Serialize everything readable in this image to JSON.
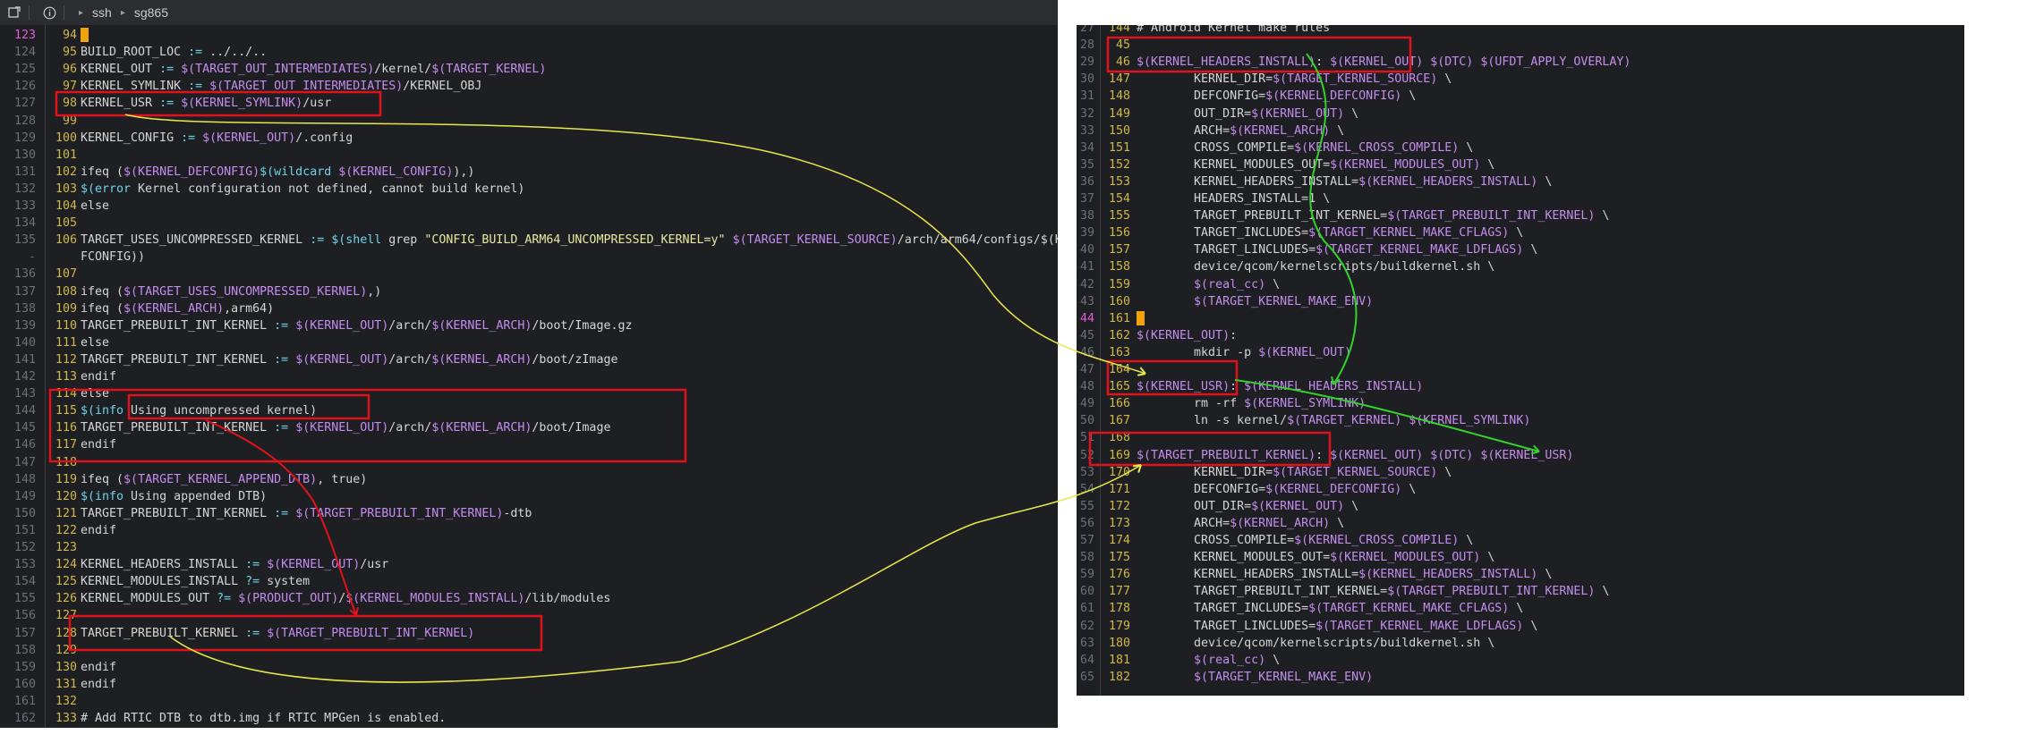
{
  "titlebar": {
    "crumbs": [
      "ssh",
      "sg865"
    ]
  },
  "colors": {
    "editor_bg": "#1e1f22",
    "text": "#d5d5d5",
    "linenum": "#6b7079",
    "rel_linenum": "#d1b84a",
    "current_line": "#e45ad8",
    "highlight_box": "#e0121b",
    "arrow_yellow": "#e8e84a",
    "arrow_red": "#e0121b",
    "arrow_green": "#34d12e",
    "purple_var": "#c58cf0",
    "cyan_op": "#6fd3e8",
    "comment": "#d5d5d5"
  },
  "left_editor": {
    "lines": [
      {
        "ln1": "123",
        "ln2": "94",
        "text": "",
        "cursor": true,
        "current": true
      },
      {
        "ln1": "124",
        "ln2": "95",
        "text": "BUILD_ROOT_LOC := ../../.."
      },
      {
        "ln1": "125",
        "ln2": "96",
        "text": "KERNEL_OUT := $(TARGET_OUT_INTERMEDIATES)/kernel/$(TARGET_KERNEL)"
      },
      {
        "ln1": "126",
        "ln2": "97",
        "text": "KERNEL_SYMLINK := $(TARGET_OUT_INTERMEDIATES)/KERNEL_OBJ"
      },
      {
        "ln1": "127",
        "ln2": "98",
        "text": "KERNEL_USR := $(KERNEL_SYMLINK)/usr"
      },
      {
        "ln1": "128",
        "ln2": "99",
        "text": ""
      },
      {
        "ln1": "129",
        "ln2": "100",
        "text": "KERNEL_CONFIG := $(KERNEL_OUT)/.config"
      },
      {
        "ln1": "130",
        "ln2": "101",
        "text": ""
      },
      {
        "ln1": "131",
        "ln2": "102",
        "text": "ifeq ($(KERNEL_DEFCONFIG)$(wildcard $(KERNEL_CONFIG)),)"
      },
      {
        "ln1": "132",
        "ln2": "103",
        "text": "$(error Kernel configuration not defined, cannot build kernel)"
      },
      {
        "ln1": "133",
        "ln2": "104",
        "text": "else"
      },
      {
        "ln1": "134",
        "ln2": "105",
        "text": ""
      },
      {
        "ln1": "135",
        "ln2": "106",
        "text": "TARGET_USES_UNCOMPRESSED_KERNEL := $(shell grep \"CONFIG_BUILD_ARM64_UNCOMPRESSED_KERNEL=y\" $(TARGET_KERNEL_SOURCE)/arch/arm64/configs/$(KERNEL_DE"
      },
      {
        "ln1": "-",
        "ln2": "",
        "text": "FCONFIG))"
      },
      {
        "ln1": "136",
        "ln2": "107",
        "text": ""
      },
      {
        "ln1": "137",
        "ln2": "108",
        "text": "ifeq ($(TARGET_USES_UNCOMPRESSED_KERNEL),)"
      },
      {
        "ln1": "138",
        "ln2": "109",
        "text": "ifeq ($(KERNEL_ARCH),arm64)"
      },
      {
        "ln1": "139",
        "ln2": "110",
        "text": "TARGET_PREBUILT_INT_KERNEL := $(KERNEL_OUT)/arch/$(KERNEL_ARCH)/boot/Image.gz"
      },
      {
        "ln1": "140",
        "ln2": "111",
        "text": "else"
      },
      {
        "ln1": "141",
        "ln2": "112",
        "text": "TARGET_PREBUILT_INT_KERNEL := $(KERNEL_OUT)/arch/$(KERNEL_ARCH)/boot/zImage"
      },
      {
        "ln1": "142",
        "ln2": "113",
        "text": "endif"
      },
      {
        "ln1": "143",
        "ln2": "114",
        "text": "else"
      },
      {
        "ln1": "144",
        "ln2": "115",
        "text": "$(info Using uncompressed kernel)"
      },
      {
        "ln1": "145",
        "ln2": "116",
        "text": "TARGET_PREBUILT_INT_KERNEL := $(KERNEL_OUT)/arch/$(KERNEL_ARCH)/boot/Image"
      },
      {
        "ln1": "146",
        "ln2": "117",
        "text": "endif"
      },
      {
        "ln1": "147",
        "ln2": "118",
        "text": ""
      },
      {
        "ln1": "148",
        "ln2": "119",
        "text": "ifeq ($(TARGET_KERNEL_APPEND_DTB), true)"
      },
      {
        "ln1": "149",
        "ln2": "120",
        "text": "$(info Using appended DTB)"
      },
      {
        "ln1": "150",
        "ln2": "121",
        "text": "TARGET_PREBUILT_INT_KERNEL := $(TARGET_PREBUILT_INT_KERNEL)-dtb"
      },
      {
        "ln1": "151",
        "ln2": "122",
        "text": "endif"
      },
      {
        "ln1": "152",
        "ln2": "123",
        "text": ""
      },
      {
        "ln1": "153",
        "ln2": "124",
        "text": "KERNEL_HEADERS_INSTALL := $(KERNEL_OUT)/usr"
      },
      {
        "ln1": "154",
        "ln2": "125",
        "text": "KERNEL_MODULES_INSTALL ?= system"
      },
      {
        "ln1": "155",
        "ln2": "126",
        "text": "KERNEL_MODULES_OUT ?= $(PRODUCT_OUT)/$(KERNEL_MODULES_INSTALL)/lib/modules"
      },
      {
        "ln1": "156",
        "ln2": "127",
        "text": ""
      },
      {
        "ln1": "157",
        "ln2": "128",
        "text": "TARGET_PREBUILT_KERNEL := $(TARGET_PREBUILT_INT_KERNEL)"
      },
      {
        "ln1": "158",
        "ln2": "129",
        "text": ""
      },
      {
        "ln1": "159",
        "ln2": "130",
        "text": "endif"
      },
      {
        "ln1": "160",
        "ln2": "131",
        "text": "endif"
      },
      {
        "ln1": "161",
        "ln2": "132",
        "text": ""
      },
      {
        "ln1": "162",
        "ln2": "133",
        "text": "# Add RTIC DTB to dtb.img if RTIC MPGen is enabled."
      }
    ]
  },
  "right_editor": {
    "lines": [
      {
        "ln1": "27",
        "ln2": "144",
        "text": "# Android Kernel make rules"
      },
      {
        "ln1": "28",
        "ln2": "45",
        "text": ""
      },
      {
        "ln1": "29",
        "ln2": "46",
        "text": "$(KERNEL_HEADERS_INSTALL): $(KERNEL_OUT) $(DTC) $(UFDT_APPLY_OVERLAY)"
      },
      {
        "ln1": "30",
        "ln2": "147",
        "text": "        KERNEL_DIR=$(TARGET_KERNEL_SOURCE) \\"
      },
      {
        "ln1": "31",
        "ln2": "148",
        "text": "        DEFCONFIG=$(KERNEL_DEFCONFIG) \\"
      },
      {
        "ln1": "32",
        "ln2": "149",
        "text": "        OUT_DIR=$(KERNEL_OUT) \\"
      },
      {
        "ln1": "33",
        "ln2": "150",
        "text": "        ARCH=$(KERNEL_ARCH) \\"
      },
      {
        "ln1": "34",
        "ln2": "151",
        "text": "        CROSS_COMPILE=$(KERNEL_CROSS_COMPILE) \\"
      },
      {
        "ln1": "35",
        "ln2": "152",
        "text": "        KERNEL_MODULES_OUT=$(KERNEL_MODULES_OUT) \\"
      },
      {
        "ln1": "36",
        "ln2": "153",
        "text": "        KERNEL_HEADERS_INSTALL=$(KERNEL_HEADERS_INSTALL) \\"
      },
      {
        "ln1": "37",
        "ln2": "154",
        "text": "        HEADERS_INSTALL=1 \\"
      },
      {
        "ln1": "38",
        "ln2": "155",
        "text": "        TARGET_PREBUILT_INT_KERNEL=$(TARGET_PREBUILT_INT_KERNEL) \\"
      },
      {
        "ln1": "39",
        "ln2": "156",
        "text": "        TARGET_INCLUDES=$(TARGET_KERNEL_MAKE_CFLAGS) \\"
      },
      {
        "ln1": "40",
        "ln2": "157",
        "text": "        TARGET_LINCLUDES=$(TARGET_KERNEL_MAKE_LDFLAGS) \\"
      },
      {
        "ln1": "41",
        "ln2": "158",
        "text": "        device/qcom/kernelscripts/buildkernel.sh \\"
      },
      {
        "ln1": "42",
        "ln2": "159",
        "text": "        $(real_cc) \\"
      },
      {
        "ln1": "43",
        "ln2": "160",
        "text": "        $(TARGET_KERNEL_MAKE_ENV)"
      },
      {
        "ln1": "44",
        "ln2": "161",
        "text": "",
        "cursor": true,
        "current": true
      },
      {
        "ln1": "45",
        "ln2": "162",
        "text": "$(KERNEL_OUT):"
      },
      {
        "ln1": "46",
        "ln2": "163",
        "text": "        mkdir -p $(KERNEL_OUT)"
      },
      {
        "ln1": "47",
        "ln2": "164",
        "text": ""
      },
      {
        "ln1": "48",
        "ln2": "165",
        "text": "$(KERNEL_USR): $(KERNEL_HEADERS_INSTALL)"
      },
      {
        "ln1": "49",
        "ln2": "166",
        "text": "        rm -rf $(KERNEL_SYMLINK)"
      },
      {
        "ln1": "50",
        "ln2": "167",
        "text": "        ln -s kernel/$(TARGET_KERNEL) $(KERNEL_SYMLINK)"
      },
      {
        "ln1": "51",
        "ln2": "168",
        "text": ""
      },
      {
        "ln1": "52",
        "ln2": "169",
        "text": "$(TARGET_PREBUILT_KERNEL): $(KERNEL_OUT) $(DTC) $(KERNEL_USR)"
      },
      {
        "ln1": "53",
        "ln2": "170",
        "text": "        KERNEL_DIR=$(TARGET_KERNEL_SOURCE) \\"
      },
      {
        "ln1": "54",
        "ln2": "171",
        "text": "        DEFCONFIG=$(KERNEL_DEFCONFIG) \\"
      },
      {
        "ln1": "55",
        "ln2": "172",
        "text": "        OUT_DIR=$(KERNEL_OUT) \\"
      },
      {
        "ln1": "56",
        "ln2": "173",
        "text": "        ARCH=$(KERNEL_ARCH) \\"
      },
      {
        "ln1": "57",
        "ln2": "174",
        "text": "        CROSS_COMPILE=$(KERNEL_CROSS_COMPILE) \\"
      },
      {
        "ln1": "58",
        "ln2": "175",
        "text": "        KERNEL_MODULES_OUT=$(KERNEL_MODULES_OUT) \\"
      },
      {
        "ln1": "59",
        "ln2": "176",
        "text": "        KERNEL_HEADERS_INSTALL=$(KERNEL_HEADERS_INSTALL) \\"
      },
      {
        "ln1": "60",
        "ln2": "177",
        "text": "        TARGET_PREBUILT_INT_KERNEL=$(TARGET_PREBUILT_INT_KERNEL) \\"
      },
      {
        "ln1": "61",
        "ln2": "178",
        "text": "        TARGET_INCLUDES=$(TARGET_KERNEL_MAKE_CFLAGS) \\"
      },
      {
        "ln1": "62",
        "ln2": "179",
        "text": "        TARGET_LINCLUDES=$(TARGET_KERNEL_MAKE_LDFLAGS) \\"
      },
      {
        "ln1": "63",
        "ln2": "180",
        "text": "        device/qcom/kernelscripts/buildkernel.sh \\"
      },
      {
        "ln1": "64",
        "ln2": "181",
        "text": "        $(real_cc) \\"
      },
      {
        "ln1": "65",
        "ln2": "182",
        "text": "        $(TARGET_KERNEL_MAKE_ENV)"
      }
    ]
  }
}
